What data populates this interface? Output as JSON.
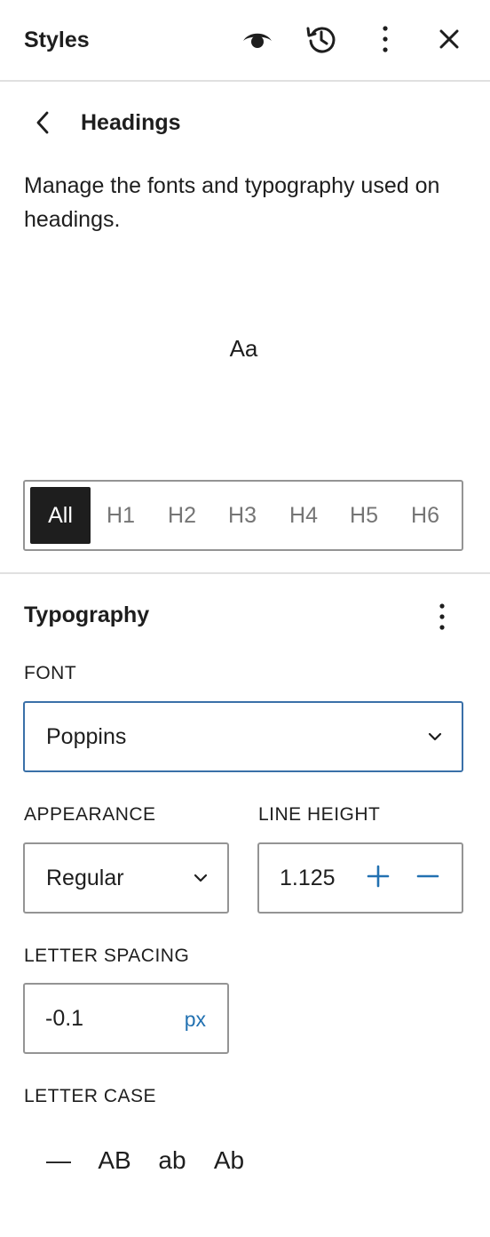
{
  "header": {
    "title": "Styles",
    "icons": [
      "eye-icon",
      "revisions-icon",
      "more-vertical-icon",
      "close-icon"
    ]
  },
  "panel": {
    "title": "Headings",
    "description": "Manage the fonts and typography used on headings."
  },
  "preview": {
    "text": "Aa"
  },
  "levels": {
    "items": [
      "All",
      "H1",
      "H2",
      "H3",
      "H4",
      "H5",
      "H6"
    ],
    "selected": "All"
  },
  "typography": {
    "section_title": "Typography",
    "font": {
      "label": "FONT",
      "value": "Poppins"
    },
    "appearance": {
      "label": "APPEARANCE",
      "value": "Regular"
    },
    "line_height": {
      "label": "LINE HEIGHT",
      "value": "1.125"
    },
    "letter_spacing": {
      "label": "LETTER SPACING",
      "value": "-0.1",
      "unit": "px"
    },
    "letter_case": {
      "label": "LETTER CASE",
      "options": [
        "—",
        "AB",
        "ab",
        "Ab"
      ]
    }
  },
  "colors": {
    "accent": "#2271b1",
    "focus_border": "#3a70a8",
    "text": "#1e1e1e",
    "muted": "#757575"
  }
}
